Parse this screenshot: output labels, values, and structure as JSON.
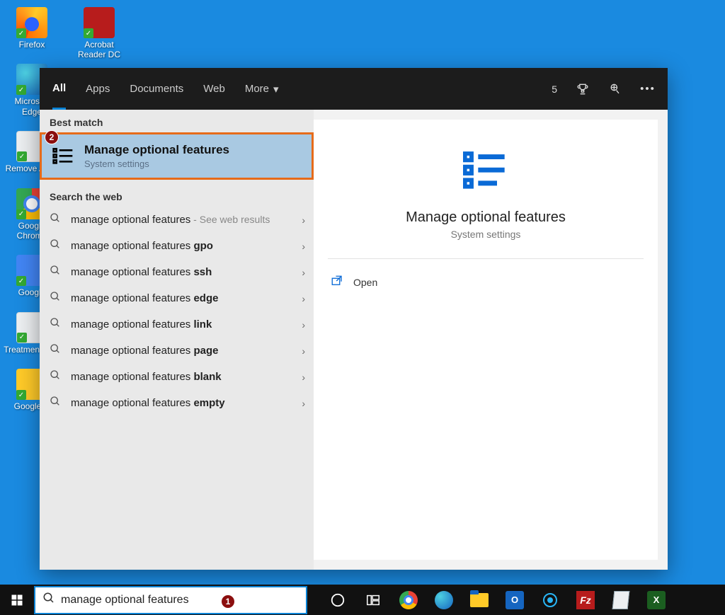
{
  "desktop": {
    "col1": [
      {
        "label": "Firefox",
        "icon": "firefox-icon",
        "iconClass": "firefox-ico"
      },
      {
        "label": "Microsoft Edge",
        "icon": "edge-icon",
        "iconClass": "edge-ico"
      },
      {
        "label": "Remove Apps",
        "icon": "bin-icon",
        "iconClass": "bin-ico"
      },
      {
        "label": "Google Chrome",
        "icon": "chrome-icon",
        "iconClass": "chrome-ico"
      },
      {
        "label": "Google",
        "icon": "docs-icon",
        "iconClass": "docs-ico"
      },
      {
        "label": "Treatment colo",
        "icon": "file-icon",
        "iconClass": "bin-ico"
      },
      {
        "label": "Google D",
        "icon": "folder-icon",
        "iconClass": "folder-ico"
      }
    ],
    "col2": [
      {
        "label": "Acrobat Reader DC",
        "icon": "acrobat-icon",
        "iconClass": "acrobat-ico"
      }
    ]
  },
  "search": {
    "tabs": [
      "All",
      "Apps",
      "Documents",
      "Web",
      "More"
    ],
    "activeTab": 0,
    "points": "5",
    "sections": {
      "bestMatchLabel": "Best match",
      "searchWebLabel": "Search the web"
    },
    "bestMatch": {
      "title": "Manage optional features",
      "subtitle": "System settings"
    },
    "webResults": [
      {
        "prefix": "manage optional features",
        "bold": "",
        "sub": " - See web results"
      },
      {
        "prefix": "manage optional features ",
        "bold": "gpo",
        "sub": ""
      },
      {
        "prefix": "manage optional features ",
        "bold": "ssh",
        "sub": ""
      },
      {
        "prefix": "manage optional features ",
        "bold": "edge",
        "sub": ""
      },
      {
        "prefix": "manage optional features ",
        "bold": "link",
        "sub": ""
      },
      {
        "prefix": "manage optional features ",
        "bold": "page",
        "sub": ""
      },
      {
        "prefix": "manage optional features ",
        "bold": "blank",
        "sub": ""
      },
      {
        "prefix": "manage optional features ",
        "bold": "empty",
        "sub": ""
      }
    ],
    "preview": {
      "title": "Manage optional features",
      "subtitle": "System settings",
      "actions": [
        {
          "label": "Open",
          "icon": "open-icon"
        }
      ]
    },
    "input": "manage optional features"
  },
  "callouts": {
    "one": "1",
    "two": "2"
  },
  "taskbar": {
    "pinned": [
      {
        "name": "cortana-icon"
      },
      {
        "name": "taskview-icon"
      },
      {
        "name": "chrome-icon"
      },
      {
        "name": "edge-icon"
      },
      {
        "name": "file-explorer-icon"
      },
      {
        "name": "outlook-icon"
      },
      {
        "name": "groove-icon"
      },
      {
        "name": "filezilla-icon"
      },
      {
        "name": "notepad-icon"
      },
      {
        "name": "excel-icon"
      }
    ]
  }
}
